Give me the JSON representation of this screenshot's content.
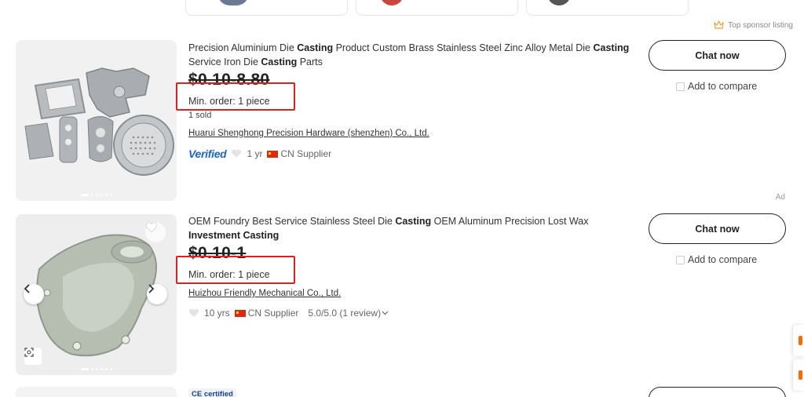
{
  "sponsor": {
    "label": "Top sponsor listing"
  },
  "listings": [
    {
      "title_parts": [
        {
          "text": "Precision Aluminium Die ",
          "bold": false
        },
        {
          "text": "Casting",
          "bold": true
        },
        {
          "text": " Product Custom Brass Stainless Steel Zinc Alloy Metal Die ",
          "bold": false
        },
        {
          "text": "Casting",
          "bold": true
        },
        {
          "text": " Service Iron Die ",
          "bold": false
        },
        {
          "text": "Casting",
          "bold": true
        },
        {
          "text": " Parts",
          "bold": false
        }
      ],
      "price": "$0.10-8.80",
      "min_order": "Min. order: 1 piece",
      "sold": "1 sold",
      "supplier": "Huarui Shenghong Precision Hardware (shenzhen) Co., Ltd.",
      "verified": "Verified",
      "years": "1 yr",
      "country": "CN Supplier",
      "chat_label": "Chat now",
      "compare_label": "Add to compare",
      "ad_label": "Ad"
    },
    {
      "title_parts": [
        {
          "text": "OEM Foundry Best Service Stainless Steel Die ",
          "bold": false
        },
        {
          "text": "Casting",
          "bold": true
        },
        {
          "text": " OEM Aluminum Precision Lost Wax ",
          "bold": false
        },
        {
          "text": "Investment Casting",
          "bold": true
        }
      ],
      "price": "$0.10-1",
      "min_order": "Min. order: 1 piece",
      "supplier": "Huizhou Friendly Mechanical Co., Ltd.",
      "years": "10 yrs",
      "country": "CN Supplier",
      "rating": "5.0/5.0 (1 review)",
      "chat_label": "Chat now",
      "compare_label": "Add to compare"
    }
  ],
  "third_listing": {
    "badge": "CE certified"
  },
  "colors": {
    "highlight_box": "#e02020",
    "verified_blue": "#1a66c9",
    "accent_orange": "#ff6a00"
  },
  "icons": [
    "crown-icon",
    "heart-icon",
    "chevron-left-icon",
    "chevron-right-icon",
    "image-search-icon",
    "chevron-down-icon",
    "cn-flag-icon"
  ]
}
